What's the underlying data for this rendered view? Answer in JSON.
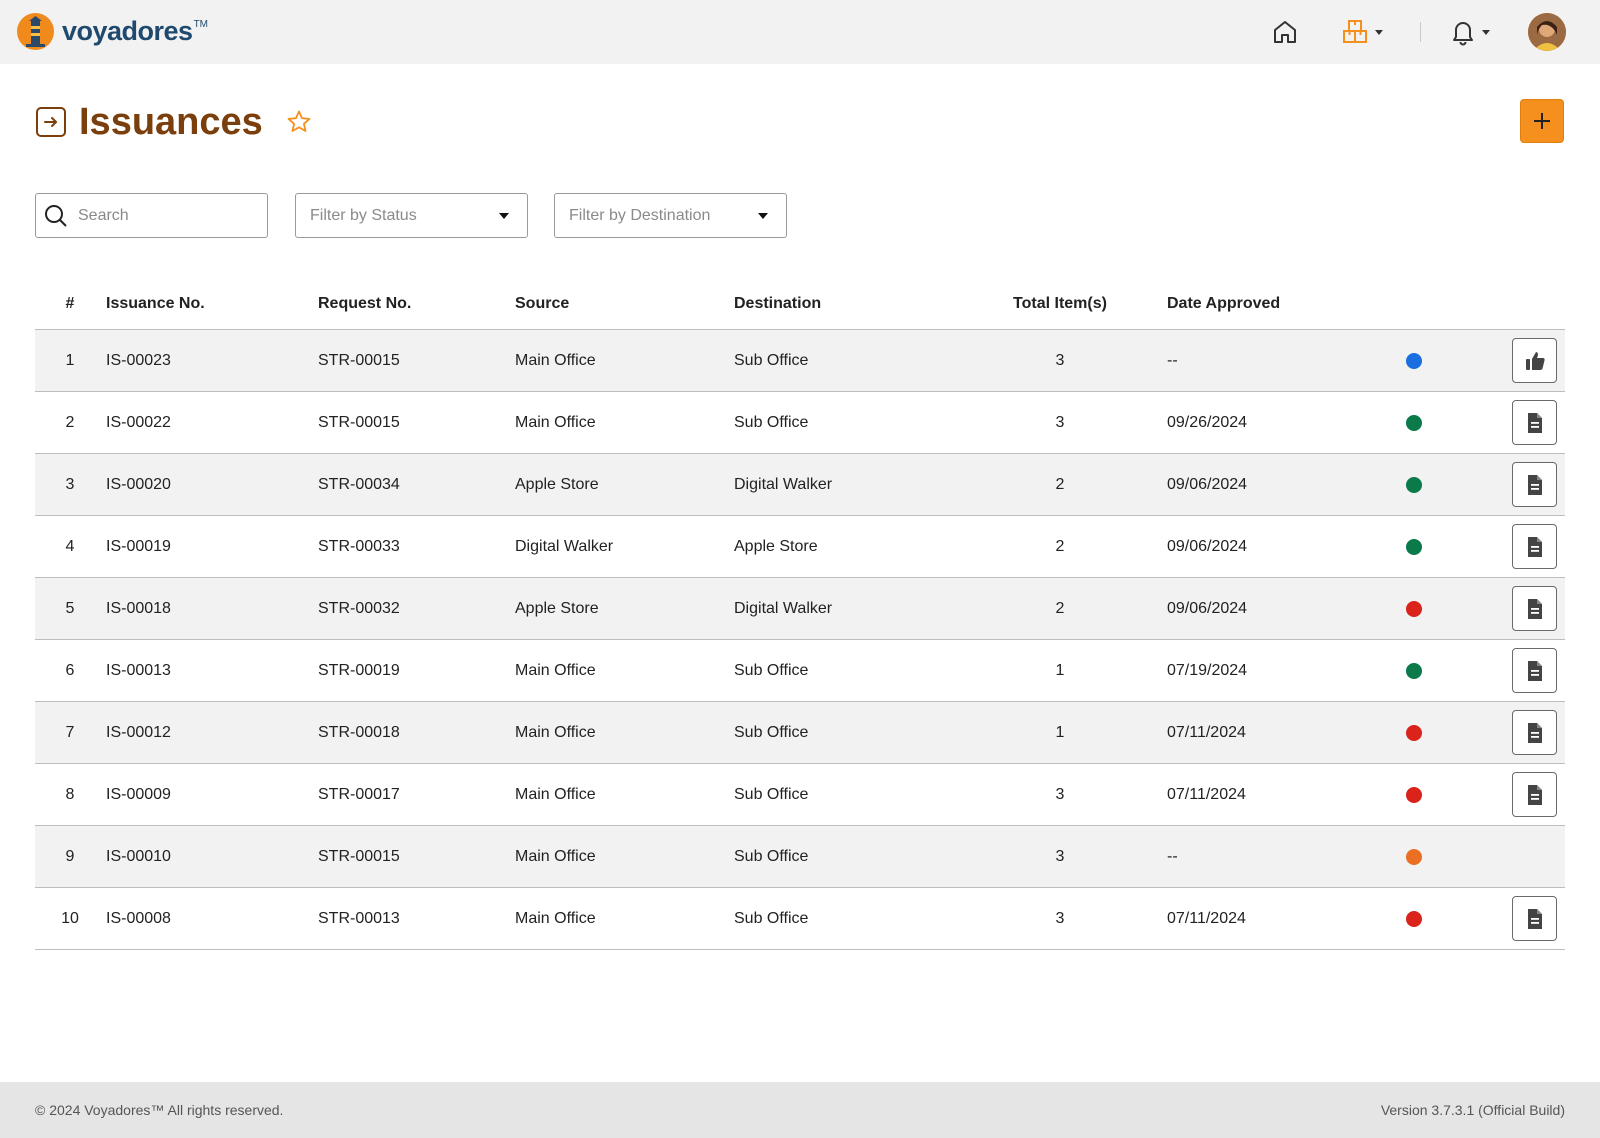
{
  "app": {
    "brand_name": "voyadores",
    "brand_tm": "TM"
  },
  "header": {
    "title": "Issuances"
  },
  "filters": {
    "search_placeholder": "Search",
    "status_placeholder": "Filter by Status",
    "destination_placeholder": "Filter by Destination"
  },
  "table": {
    "columns": [
      "#",
      "Issuance No.",
      "Request No.",
      "Source",
      "Destination",
      "Total Item(s)",
      "Date Approved"
    ],
    "rows": [
      {
        "num": "1",
        "issuance": "IS-00023",
        "request": "STR-00015",
        "source": "Main Office",
        "destination": "Sub Office",
        "total": "3",
        "date": "--",
        "status_color": "#1a6fe0",
        "action": "thumbs-up-icon"
      },
      {
        "num": "2",
        "issuance": "IS-00022",
        "request": "STR-00015",
        "source": "Main Office",
        "destination": "Sub Office",
        "total": "3",
        "date": "09/26/2024",
        "status_color": "#0a7a4a",
        "action": "document-icon"
      },
      {
        "num": "3",
        "issuance": "IS-00020",
        "request": "STR-00034",
        "source": "Apple Store",
        "destination": "Digital Walker",
        "total": "2",
        "date": "09/06/2024",
        "status_color": "#0a7a4a",
        "action": "document-icon"
      },
      {
        "num": "4",
        "issuance": "IS-00019",
        "request": "STR-00033",
        "source": "Digital Walker",
        "destination": "Apple Store",
        "total": "2",
        "date": "09/06/2024",
        "status_color": "#0a7a4a",
        "action": "document-icon"
      },
      {
        "num": "5",
        "issuance": "IS-00018",
        "request": "STR-00032",
        "source": "Apple Store",
        "destination": "Digital Walker",
        "total": "2",
        "date": "09/06/2024",
        "status_color": "#d9231b",
        "action": "document-icon"
      },
      {
        "num": "6",
        "issuance": "IS-00013",
        "request": "STR-00019",
        "source": "Main Office",
        "destination": "Sub Office",
        "total": "1",
        "date": "07/19/2024",
        "status_color": "#0a7a4a",
        "action": "document-icon"
      },
      {
        "num": "7",
        "issuance": "IS-00012",
        "request": "STR-00018",
        "source": "Main Office",
        "destination": "Sub Office",
        "total": "1",
        "date": "07/11/2024",
        "status_color": "#d9231b",
        "action": "document-icon"
      },
      {
        "num": "8",
        "issuance": "IS-00009",
        "request": "STR-00017",
        "source": "Main Office",
        "destination": "Sub Office",
        "total": "3",
        "date": "07/11/2024",
        "status_color": "#d9231b",
        "action": "document-icon"
      },
      {
        "num": "9",
        "issuance": "IS-00010",
        "request": "STR-00015",
        "source": "Main Office",
        "destination": "Sub Office",
        "total": "3",
        "date": "--",
        "status_color": "#ea6f25",
        "action": ""
      },
      {
        "num": "10",
        "issuance": "IS-00008",
        "request": "STR-00013",
        "source": "Main Office",
        "destination": "Sub Office",
        "total": "3",
        "date": "07/11/2024",
        "status_color": "#d9231b",
        "action": "document-icon"
      }
    ]
  },
  "footer": {
    "copyright": "© 2024 Voyadores™ All rights reserved.",
    "version": "Version 3.7.3.1 (Official Build)"
  },
  "colors": {
    "brand_orange": "#f5901f",
    "title_brown": "#7a3f0c",
    "brand_blue": "#1f4a6e"
  }
}
